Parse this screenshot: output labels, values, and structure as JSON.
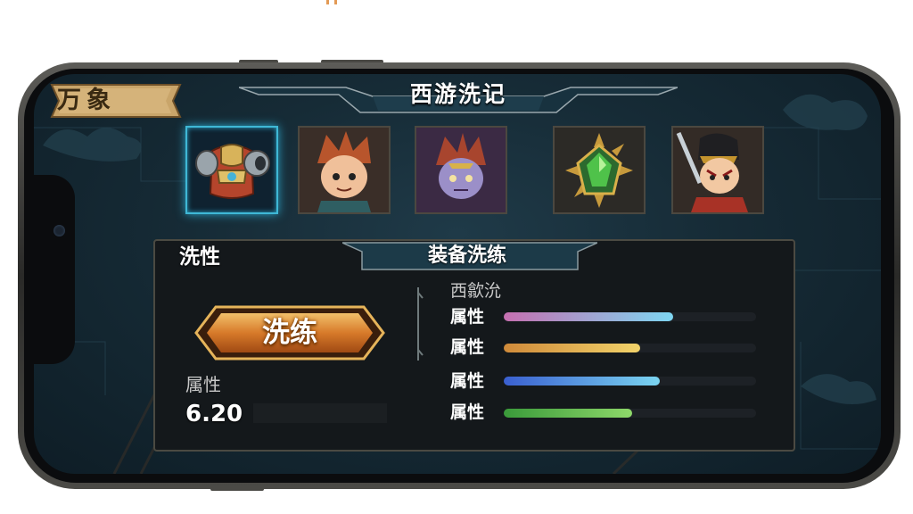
{
  "header": {
    "badge_label": "万象",
    "title": "西游洗记"
  },
  "equipment_slots": [
    {
      "name": "armor-slot",
      "selected": true
    },
    {
      "name": "hero-slot-1",
      "selected": false
    },
    {
      "name": "hero-slot-2",
      "selected": false
    },
    {
      "name": "gem-slot",
      "selected": false
    },
    {
      "name": "hero-slot-3",
      "selected": false
    }
  ],
  "panel": {
    "left_title": "洗性",
    "header_title": "装备洗练",
    "wash_button_label": "洗练",
    "attribute_label": "属性",
    "attribute_value": "6.20",
    "stats_title": "西歙沇",
    "stats": [
      {
        "label": "属性",
        "value": 0.67,
        "color_start": "#c56fb0",
        "color_end": "#7ed6f2"
      },
      {
        "label": "属性",
        "value": 0.54,
        "color_start": "#d08a3a",
        "color_end": "#f2d36a"
      },
      {
        "label": "属性",
        "value": 0.62,
        "color_start": "#3a5fd0",
        "color_end": "#7ad4f0"
      },
      {
        "label": "属性",
        "value": 0.51,
        "color_start": "#3a9a3a",
        "color_end": "#8ed86a"
      }
    ]
  },
  "colors": {
    "accent_cyan": "#3fb8d6",
    "gold": "#e6a44a",
    "panel_bg": "#14181b"
  }
}
